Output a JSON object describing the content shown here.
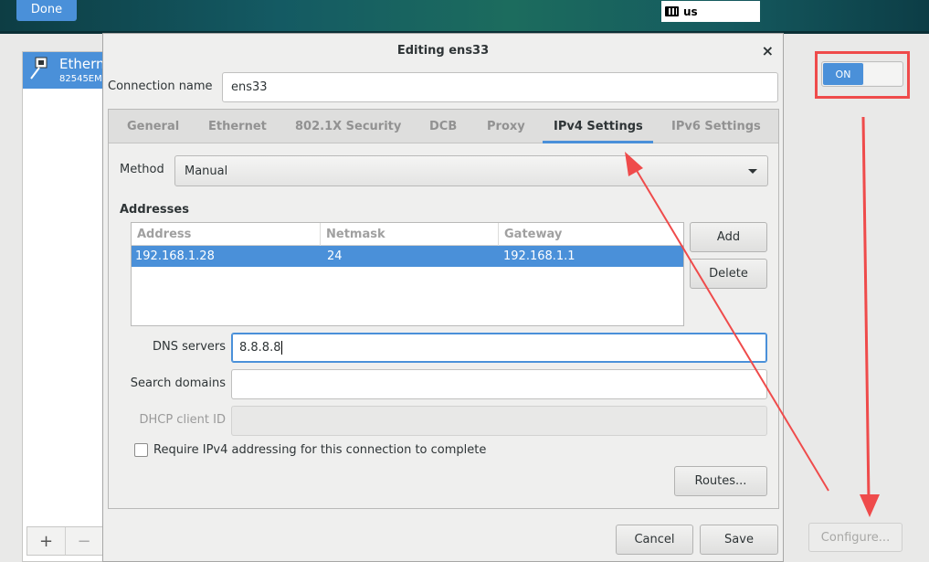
{
  "header": {
    "done_label": "Done",
    "keyboard_layout": "us"
  },
  "left_panel": {
    "connection_name": "Ethernet",
    "connection_device": "82545EM",
    "add_glyph": "+",
    "remove_glyph": "−"
  },
  "toggle": {
    "label": "ON"
  },
  "configure_label": "Configure...",
  "dialog": {
    "title": "Editing ens33",
    "close_glyph": "×",
    "connection_name_label": "Connection name",
    "connection_name_value": "ens33",
    "tabs": [
      {
        "label": "General"
      },
      {
        "label": "Ethernet"
      },
      {
        "label": "802.1X Security"
      },
      {
        "label": "DCB"
      },
      {
        "label": "Proxy"
      },
      {
        "label": "IPv4 Settings",
        "active": true
      },
      {
        "label": "IPv6 Settings"
      }
    ],
    "method_label": "Method",
    "method_value": "Manual",
    "addresses_label": "Addresses",
    "addresses": {
      "columns": [
        "Address",
        "Netmask",
        "Gateway"
      ],
      "rows": [
        {
          "address": "192.168.1.28",
          "netmask": "24",
          "gateway": "192.168.1.1",
          "selected": true
        }
      ]
    },
    "add_label": "Add",
    "delete_label": "Delete",
    "dns_label": "DNS servers",
    "dns_value": "8.8.8.8",
    "search_label": "Search domains",
    "search_value": "",
    "dhcp_label": "DHCP client ID",
    "dhcp_value": "",
    "require_label": "Require IPv4 addressing for this connection to complete",
    "require_checked": false,
    "routes_label": "Routes...",
    "cancel_label": "Cancel",
    "save_label": "Save"
  },
  "colors": {
    "accent": "#4a90d9",
    "annotation": "#ef4b4b"
  }
}
